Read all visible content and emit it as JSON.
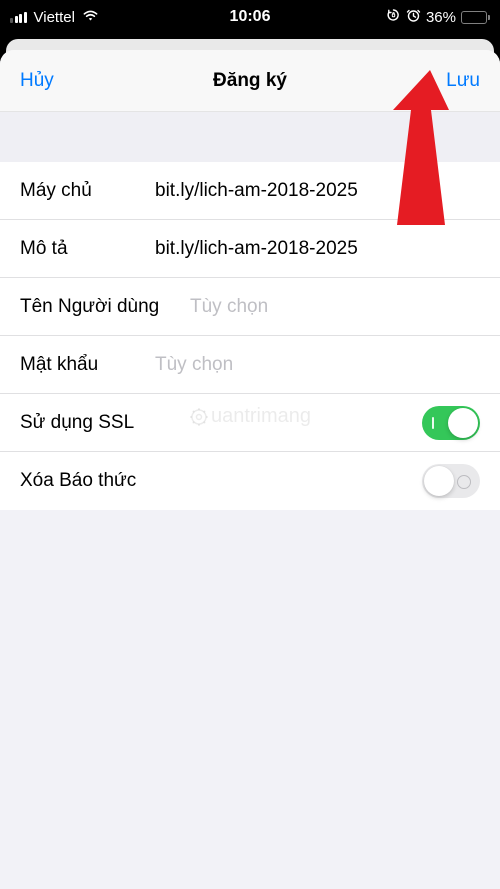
{
  "status_bar": {
    "carrier": "Viettel",
    "time": "10:06",
    "battery_percent": "36%"
  },
  "nav": {
    "cancel": "Hủy",
    "title": "Đăng ký",
    "save": "Lưu"
  },
  "form": {
    "server": {
      "label": "Máy chủ",
      "value": "bit.ly/lich-am-2018-2025"
    },
    "description": {
      "label": "Mô tả",
      "value": "bit.ly/lich-am-2018-2025"
    },
    "username": {
      "label": "Tên Người dùng",
      "placeholder": "Tùy chọn"
    },
    "password": {
      "label": "Mật khẩu",
      "placeholder": "Tùy chọn"
    },
    "ssl": {
      "label": "Sử dụng SSL"
    },
    "remove_alarms": {
      "label": "Xóa Báo thức"
    }
  },
  "watermark": "uantrimang"
}
